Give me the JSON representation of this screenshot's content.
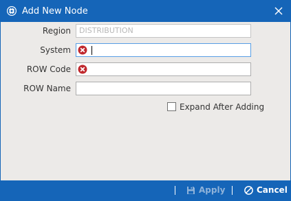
{
  "window": {
    "title": "Add New Node",
    "icon": "app-logo-icon",
    "close_icon": "close-icon"
  },
  "form": {
    "region": {
      "label": "Region",
      "value": "DISTRIBUTION",
      "state": "disabled"
    },
    "system": {
      "label": "System",
      "value": "",
      "state": "error"
    },
    "row_code": {
      "label": "ROW Code",
      "value": "",
      "state": "error"
    },
    "row_name": {
      "label": "ROW Name",
      "value": ""
    },
    "expand_after_adding": {
      "label": "Expand After Adding",
      "checked": false
    }
  },
  "footer": {
    "apply": {
      "label": "Apply",
      "icon": "save-icon",
      "enabled": false
    },
    "cancel": {
      "label": "Cancel",
      "icon": "cancel-icon",
      "enabled": true
    }
  },
  "colors": {
    "accent": "#1565b8",
    "background": "#eceae8",
    "error": "#c0282d"
  }
}
